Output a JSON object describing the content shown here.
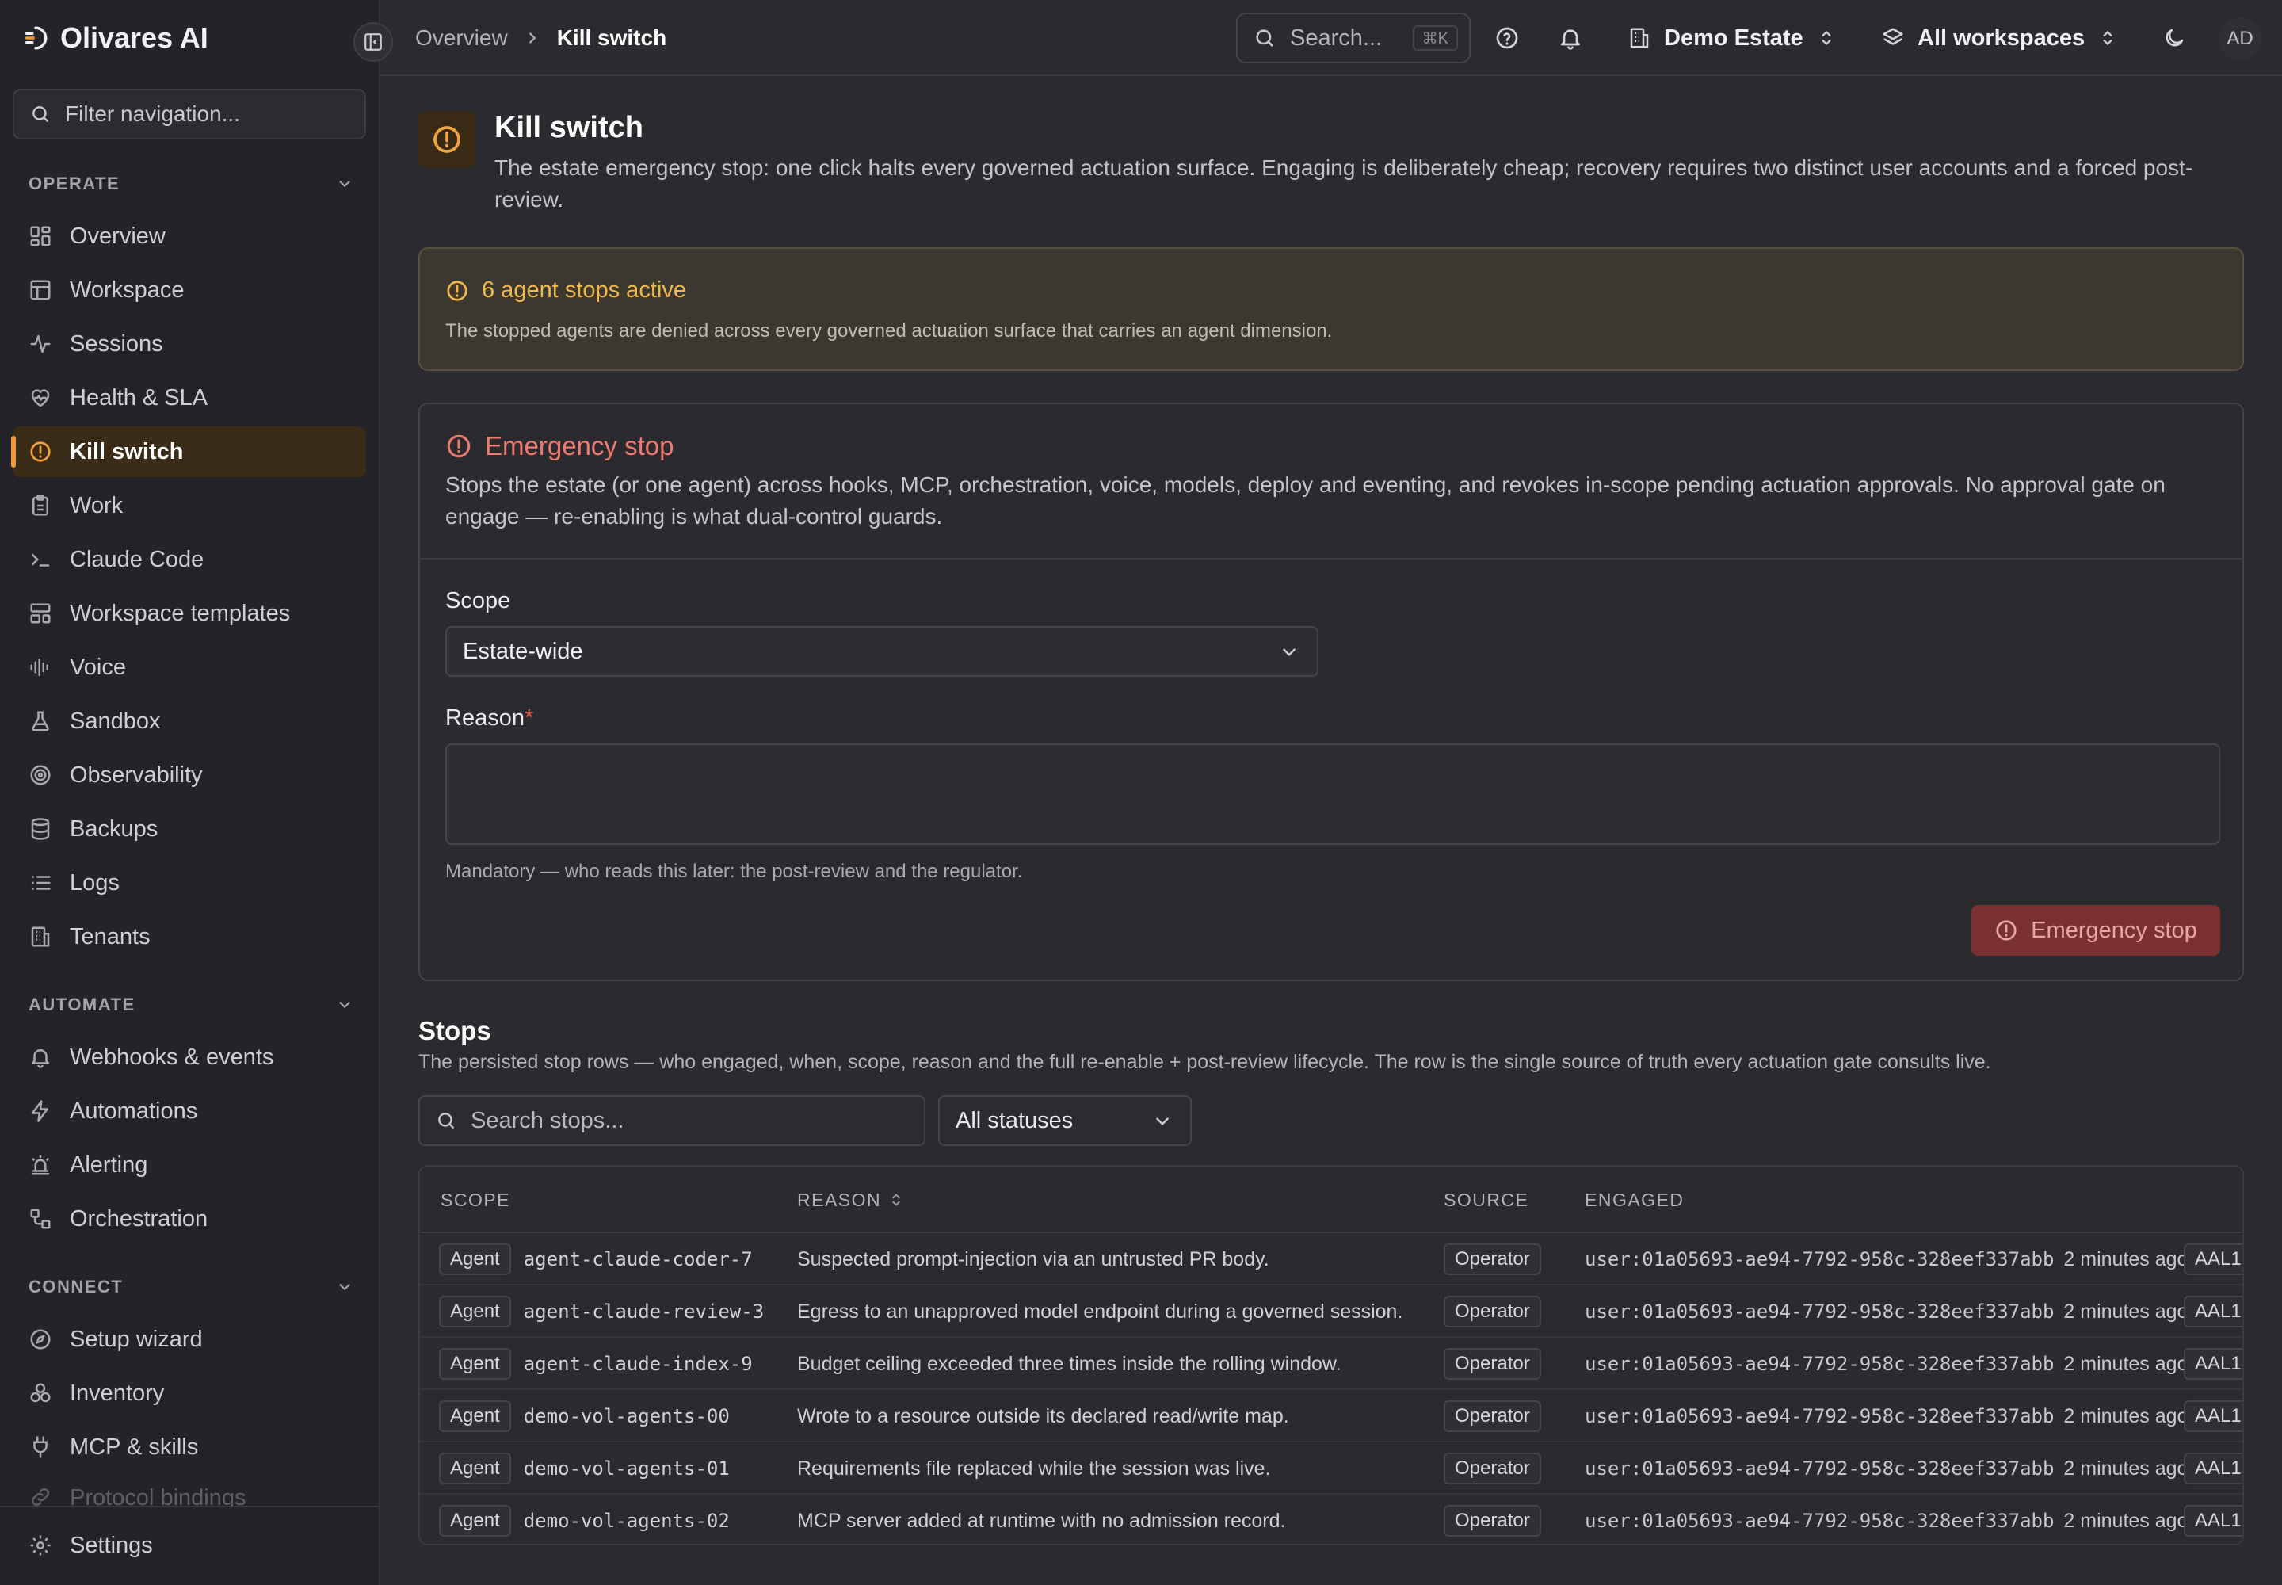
{
  "app": {
    "name": "Olivares AI"
  },
  "sidebar": {
    "filter_placeholder": "Filter navigation...",
    "sections": [
      {
        "label": "OPERATE",
        "items": [
          "Overview",
          "Workspace",
          "Sessions",
          "Health & SLA",
          "Kill switch",
          "Work",
          "Claude Code",
          "Workspace templates",
          "Voice",
          "Sandbox",
          "Observability",
          "Backups",
          "Logs",
          "Tenants"
        ]
      },
      {
        "label": "AUTOMATE",
        "items": [
          "Webhooks & events",
          "Automations",
          "Alerting",
          "Orchestration"
        ]
      },
      {
        "label": "CONNECT",
        "items": [
          "Setup wizard",
          "Inventory",
          "MCP & skills",
          "Protocol bindings"
        ]
      }
    ],
    "active_item": "Kill switch",
    "footer_item": "Settings"
  },
  "topbar": {
    "breadcrumb": [
      "Overview",
      "Kill switch"
    ],
    "search_placeholder": "Search...",
    "search_shortcut": "⌘K",
    "estate": "Demo Estate",
    "workspaces": "All workspaces",
    "avatar_initials": "AD"
  },
  "page": {
    "title": "Kill switch",
    "description": "The estate emergency stop: one click halts every governed actuation surface. Engaging is deliberately cheap; recovery requires two distinct user accounts and a forced post-review."
  },
  "alert": {
    "title": "6 agent stops active",
    "text": "The stopped agents are denied across every governed actuation surface that carries an agent dimension."
  },
  "emergency_stop": {
    "title": "Emergency stop",
    "description": "Stops the estate (or one agent) across hooks, MCP, orchestration, voice, models, deploy and eventing, and revokes in-scope pending actuation approvals. No approval gate on engage — re-enabling is what dual-control guards.",
    "scope_label": "Scope",
    "scope_value": "Estate-wide",
    "reason_label": "Reason",
    "reason_required_mark": "*",
    "reason_value": "",
    "reason_hint": "Mandatory — who reads this later: the post-review and the regulator.",
    "button_label": "Emergency stop"
  },
  "stops": {
    "title": "Stops",
    "description": "The persisted stop rows — who engaged, when, scope, reason and the full re-enable + post-review lifecycle. The row is the single source of truth every actuation gate consults live.",
    "search_placeholder": "Search stops...",
    "status_filter": "All statuses",
    "columns": [
      "SCOPE",
      "REASON",
      "SOURCE",
      "ENGAGED"
    ],
    "rows": [
      {
        "scope_type": "Agent",
        "scope_id": "agent-claude-coder-7",
        "reason": "Suspected prompt-injection via an untrusted PR body.",
        "source": "Operator",
        "engaged_by": "user:01a05693-ae94-7792-958c-328eef337abb",
        "engaged_ago": "2 minutes ago",
        "aal": "AAL1"
      },
      {
        "scope_type": "Agent",
        "scope_id": "agent-claude-review-3",
        "reason": "Egress to an unapproved model endpoint during a governed session.",
        "source": "Operator",
        "engaged_by": "user:01a05693-ae94-7792-958c-328eef337abb",
        "engaged_ago": "2 minutes ago",
        "aal": "AAL1"
      },
      {
        "scope_type": "Agent",
        "scope_id": "agent-claude-index-9",
        "reason": "Budget ceiling exceeded three times inside the rolling window.",
        "source": "Operator",
        "engaged_by": "user:01a05693-ae94-7792-958c-328eef337abb",
        "engaged_ago": "2 minutes ago",
        "aal": "AAL1"
      },
      {
        "scope_type": "Agent",
        "scope_id": "demo-vol-agents-00",
        "reason": "Wrote to a resource outside its declared read/write map.",
        "source": "Operator",
        "engaged_by": "user:01a05693-ae94-7792-958c-328eef337abb",
        "engaged_ago": "2 minutes ago",
        "aal": "AAL1"
      },
      {
        "scope_type": "Agent",
        "scope_id": "demo-vol-agents-01",
        "reason": "Requirements file replaced while the session was live.",
        "source": "Operator",
        "engaged_by": "user:01a05693-ae94-7792-958c-328eef337abb",
        "engaged_ago": "2 minutes ago",
        "aal": "AAL1"
      },
      {
        "scope_type": "Agent",
        "scope_id": "demo-vol-agents-02",
        "reason": "MCP server added at runtime with no admission record.",
        "source": "Operator",
        "engaged_by": "user:01a05693-ae94-7792-958c-328eef337abb",
        "engaged_ago": "2 minutes ago",
        "aal": "AAL1"
      }
    ]
  },
  "colors": {
    "accent": "#f29a3a",
    "danger": "#ef7a6e",
    "warning": "#f4b84a"
  }
}
